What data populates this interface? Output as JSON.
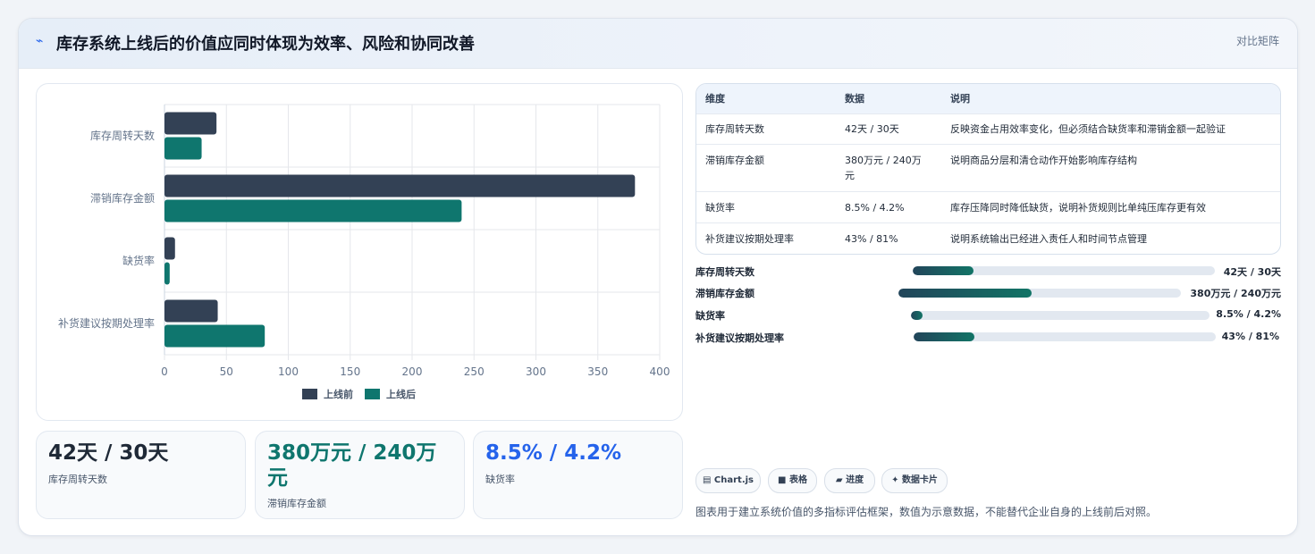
{
  "header": {
    "icon": "trend-icon",
    "title": "库存系统上线后的价值应同时体现为效率、风险和协同改善",
    "link": "对比矩阵"
  },
  "chart_data": {
    "type": "bar",
    "orientation": "horizontal",
    "categories": [
      "库存周转天数",
      "滞销库存金额",
      "缺货率",
      "补货建议按期处理率"
    ],
    "series": [
      {
        "name": "上线前",
        "values": [
          42,
          380,
          8.5,
          43
        ],
        "color": "#334155"
      },
      {
        "name": "上线后",
        "values": [
          30,
          240,
          4.2,
          81
        ],
        "color": "#0f766e"
      }
    ],
    "xlim": [
      0,
      400
    ],
    "xticks": [
      0,
      50,
      100,
      150,
      200,
      250,
      300,
      350,
      400
    ],
    "grid": true,
    "legend": "bottom"
  },
  "stats": [
    {
      "value": "42天 / 30天",
      "label": "库存周转天数",
      "color": "#1f2937"
    },
    {
      "value_line1": "380万元 / 240万",
      "value_line2": "元",
      "label": "滞销库存金额",
      "color": "#0f766e"
    },
    {
      "value": "8.5% / 4.2%",
      "label": "缺货率",
      "color": "#2563eb"
    }
  ],
  "table": {
    "headers": [
      "维度",
      "数据",
      "说明"
    ],
    "rows": [
      {
        "dim": "库存周转天数",
        "data": "42天 / 30天",
        "desc": "反映资金占用效率变化，但必须结合缺货率和滞销金额一起验证"
      },
      {
        "dim": "滞销库存金额",
        "data_line1": "380万元 / 240万",
        "data_line2": "元",
        "desc": "说明商品分层和清仓动作开始影响库存结构"
      },
      {
        "dim": "缺货率",
        "data": "8.5% / 4.2%",
        "desc": "库存压降同时降低缺货，说明补货规则比单纯压库存更有效"
      },
      {
        "dim": "补货建议按期处理率",
        "data": "43% / 81%",
        "desc": "说明系统输出已经进入责任人和时间节点管理"
      }
    ]
  },
  "progress": [
    {
      "label": "库存周转天数",
      "value": "42天 / 30天",
      "fill": 0.2
    },
    {
      "label": "滞销库存金额",
      "value": "380万元 / 240万元",
      "fill": 0.47
    },
    {
      "label": "缺货率",
      "value": "8.5% / 4.2%",
      "fill": 0.04
    },
    {
      "label": "补货建议按期处理率",
      "value": "43% / 81%",
      "fill": 0.2
    }
  ],
  "chips": [
    {
      "icon": "chart-icon",
      "label": "Chart.js"
    },
    {
      "icon": "table-icon",
      "label": "表格"
    },
    {
      "icon": "progress-icon",
      "label": "进度"
    },
    {
      "icon": "sparkle-icon",
      "label": "数据卡片"
    }
  ],
  "footnote": "图表用于建立系统价值的多指标评估框架，数值为示意数据，不能替代企业自身的上线前后对照。"
}
